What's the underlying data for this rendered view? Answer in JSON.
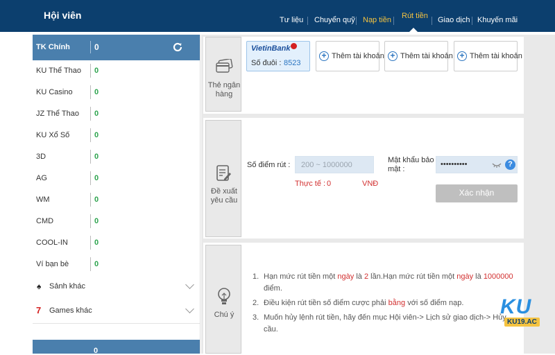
{
  "header": {
    "title": "Hội viên",
    "nav": [
      "Tư liệu",
      "Chuyển quỹ",
      "Nạp tiền",
      "Rút tiền",
      "Giao dịch",
      "Khuyến mãi"
    ]
  },
  "sidebar": {
    "main_account": {
      "label": "TK Chính",
      "value": "0"
    },
    "accounts": [
      {
        "label": "KU Thể Thao",
        "value": "0"
      },
      {
        "label": "KU Casino",
        "value": "0"
      },
      {
        "label": "JZ Thể Thao",
        "value": "0"
      },
      {
        "label": "KU Xổ Số",
        "value": "0"
      },
      {
        "label": "3D",
        "value": "0"
      },
      {
        "label": "AG",
        "value": "0"
      },
      {
        "label": "WM",
        "value": "0"
      },
      {
        "label": "CMD",
        "value": "0"
      },
      {
        "label": "COOL-IN",
        "value": "0"
      },
      {
        "label": "Ví bạn bè",
        "value": "0"
      }
    ],
    "groups": [
      "Sảnh khác",
      "Games khác"
    ],
    "footer_value": "0"
  },
  "bank_panel": {
    "tag_label": "Thẻ ngân hàng",
    "selected_bank": {
      "name": "VietinBank",
      "suffix_label": "Số đuôi :",
      "suffix_value": "8523"
    },
    "add_label": "Thêm tài khoản"
  },
  "withdraw_panel": {
    "tag_label": "Đề xuất yêu cầu",
    "amount_label": "Số điểm rút :",
    "amount_placeholder": "200 ~ 1000000",
    "actual_label": "Thực tế :",
    "actual_value": "0",
    "currency": "VNĐ",
    "password_label": "Mật khẩu bảo mật :",
    "password_value": "••••••••••",
    "confirm_label": "Xác nhận"
  },
  "notes_panel": {
    "tag_label": "Chú ý",
    "notes": [
      "Hạn mức rút tiền một ngày là 2 lần.Hạn mức rút tiền một ngày là 1000000 điểm.",
      "Điều kiện rút tiền số điểm cược phải bằng với số điểm nạp.",
      "Muốn hủy lệnh rút tiền, hãy đến mục Hội viên-> Lịch sử giao dịch-> Hủy cầu."
    ]
  },
  "watermark": {
    "brand": "KU",
    "site": "KU19.AC"
  },
  "colors": {
    "header_bg": "#0c3f6e",
    "sidebar_head": "#4a7fad",
    "value_green": "#2da44e",
    "active_tab": "#f5c340",
    "highlight_red": "#d23030"
  }
}
